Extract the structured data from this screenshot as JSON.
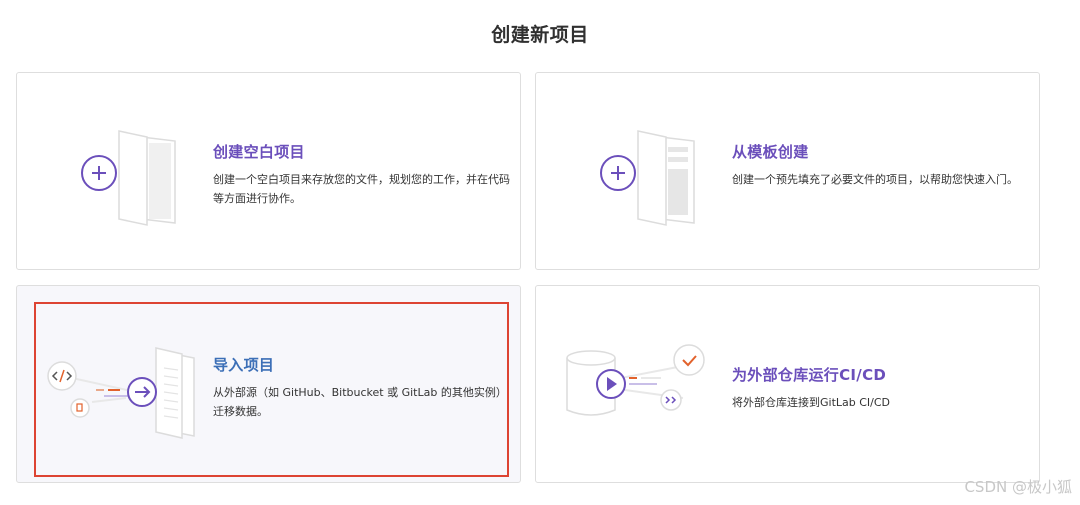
{
  "page": {
    "title": "创建新项目"
  },
  "cards": [
    {
      "id": "blank",
      "title": "创建空白项目",
      "description": "创建一个空白项目来存放您的文件，规划您的工作，并在代码等方面进行协作。",
      "icon": "plus-icon"
    },
    {
      "id": "template",
      "title": "从模板创建",
      "description": "创建一个预先填充了必要文件的项目，以帮助您快速入门。",
      "icon": "plus-icon"
    },
    {
      "id": "import",
      "title": "导入项目",
      "description": "从外部源（如 GitHub、Bitbucket 或 GitLab 的其他实例）迁移数据。",
      "icon": "arrow-right-icon"
    },
    {
      "id": "cicd",
      "title": "为外部仓库运行CI/CD",
      "description": "将外部仓库连接到GitLab CI/CD",
      "icon": "play-icon"
    }
  ],
  "watermark": "CSDN @极小狐",
  "colors": {
    "accent": "#6b4fbb",
    "import_title": "#3c6fb7",
    "highlight": "#dd4433",
    "orange": "#e2622c"
  }
}
